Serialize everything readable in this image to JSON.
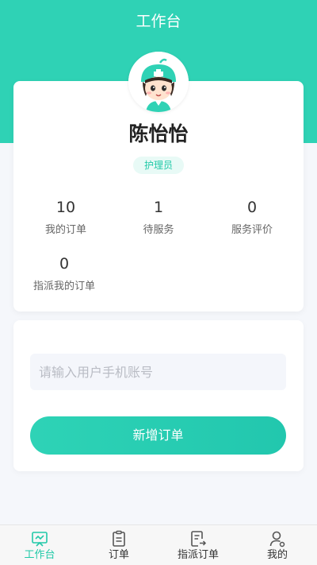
{
  "header": {
    "title": "工作台"
  },
  "profile": {
    "name": "陈怡怡",
    "role": "护理员",
    "stats": [
      {
        "value": "10",
        "label": "我的订单"
      },
      {
        "value": "1",
        "label": "待服务"
      },
      {
        "value": "0",
        "label": "服务评价"
      },
      {
        "value": "0",
        "label": "指派我的订单"
      }
    ]
  },
  "form": {
    "phone_placeholder": "请输入用户手机账号",
    "submit_label": "新增订单"
  },
  "tabbar": {
    "items": [
      {
        "label": "工作台",
        "icon": "workbench-icon",
        "active": true
      },
      {
        "label": "订单",
        "icon": "clipboard-icon",
        "active": false
      },
      {
        "label": "指派订单",
        "icon": "assign-order-icon",
        "active": false
      },
      {
        "label": "我的",
        "icon": "user-icon",
        "active": false
      }
    ]
  },
  "colors": {
    "accent": "#2fd2b5",
    "accent_text": "#21c9a8",
    "background": "#f5f7fb"
  }
}
